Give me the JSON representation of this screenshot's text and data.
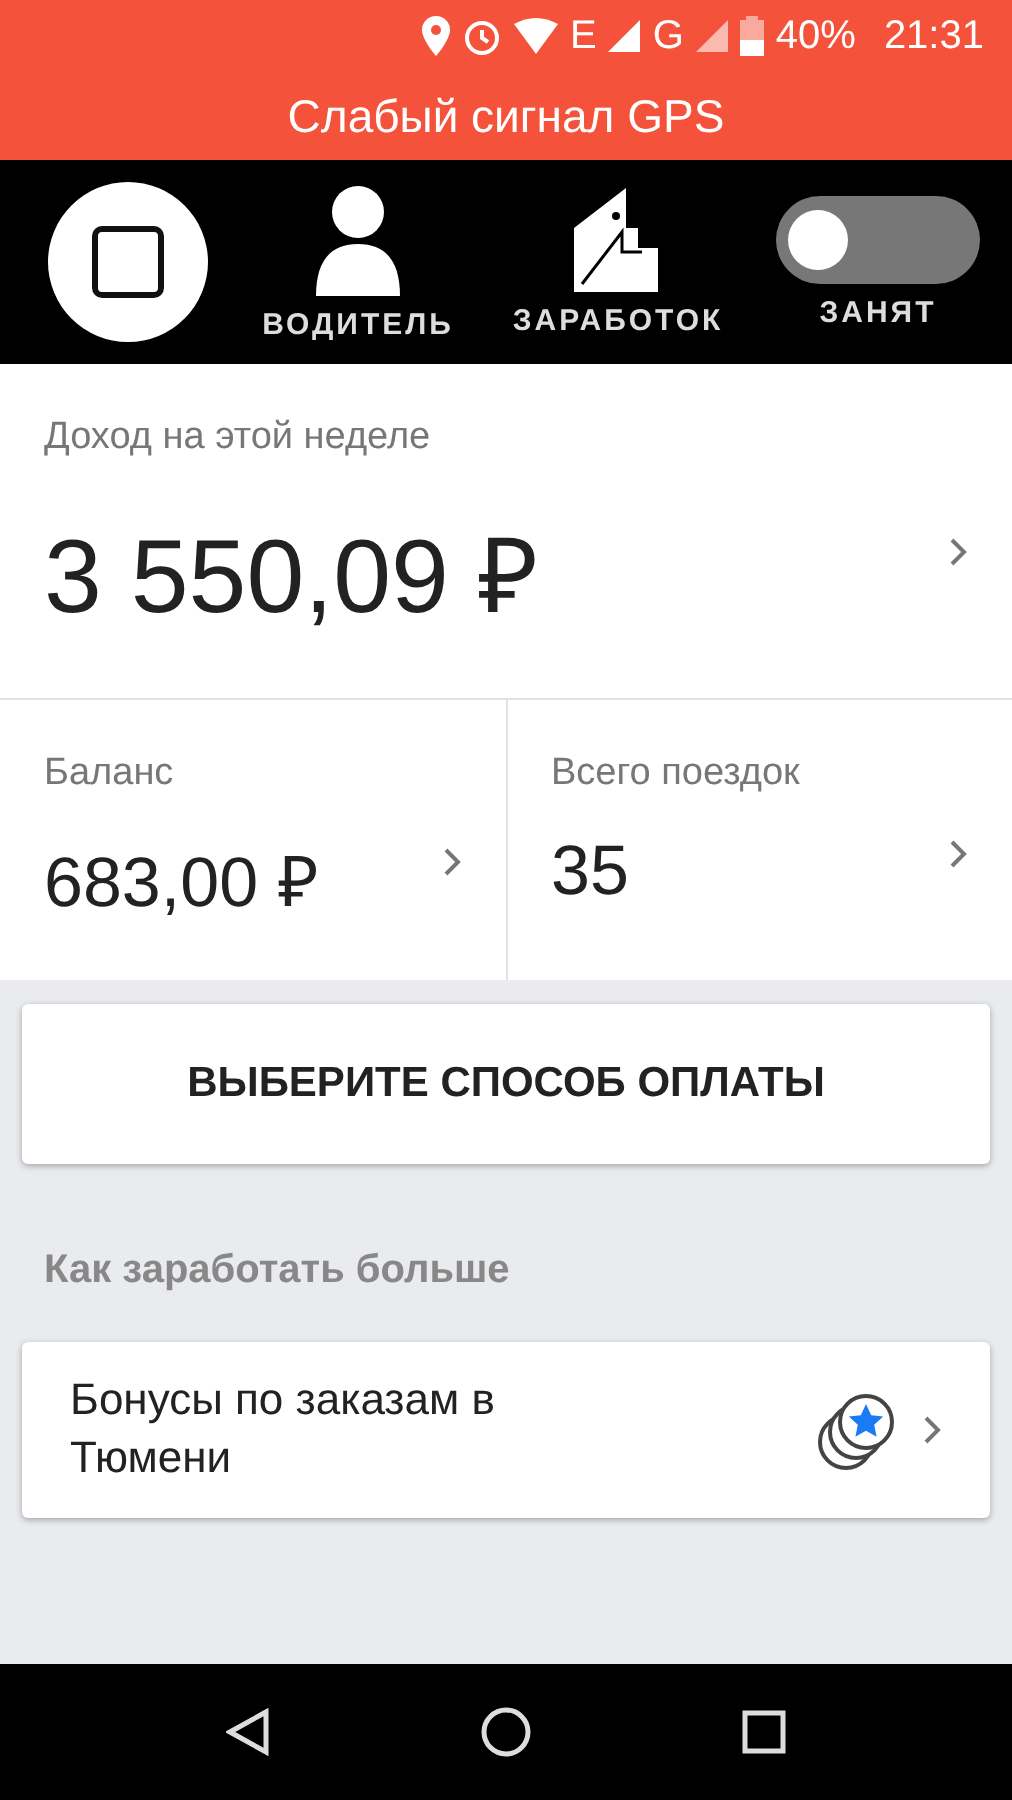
{
  "status_bar": {
    "network_1": "E",
    "network_2": "G",
    "battery": "40%",
    "time": "21:31"
  },
  "banner": {
    "text": "Слабый сигнал GPS"
  },
  "toolbar": {
    "items": [
      {
        "kind": "stop"
      },
      {
        "kind": "driver",
        "label": "ВОДИТЕЛЬ"
      },
      {
        "kind": "earnings",
        "label": "ЗАРАБОТОК"
      },
      {
        "kind": "toggle",
        "label": "ЗАНЯТ",
        "on": false
      }
    ]
  },
  "weekly_income": {
    "label": "Доход на этой неделе",
    "value": "3 550,09 ₽"
  },
  "stats": [
    {
      "label": "Баланс",
      "value": "683,00 ₽"
    },
    {
      "label": "Всего поездок",
      "value": "35"
    }
  ],
  "payment_button": "ВЫБЕРИТЕ СПОСОБ ОПЛАТЫ",
  "section_title": "Как заработать больше",
  "bonus_card": {
    "text": "Бонусы по заказам в Тюмени"
  }
}
